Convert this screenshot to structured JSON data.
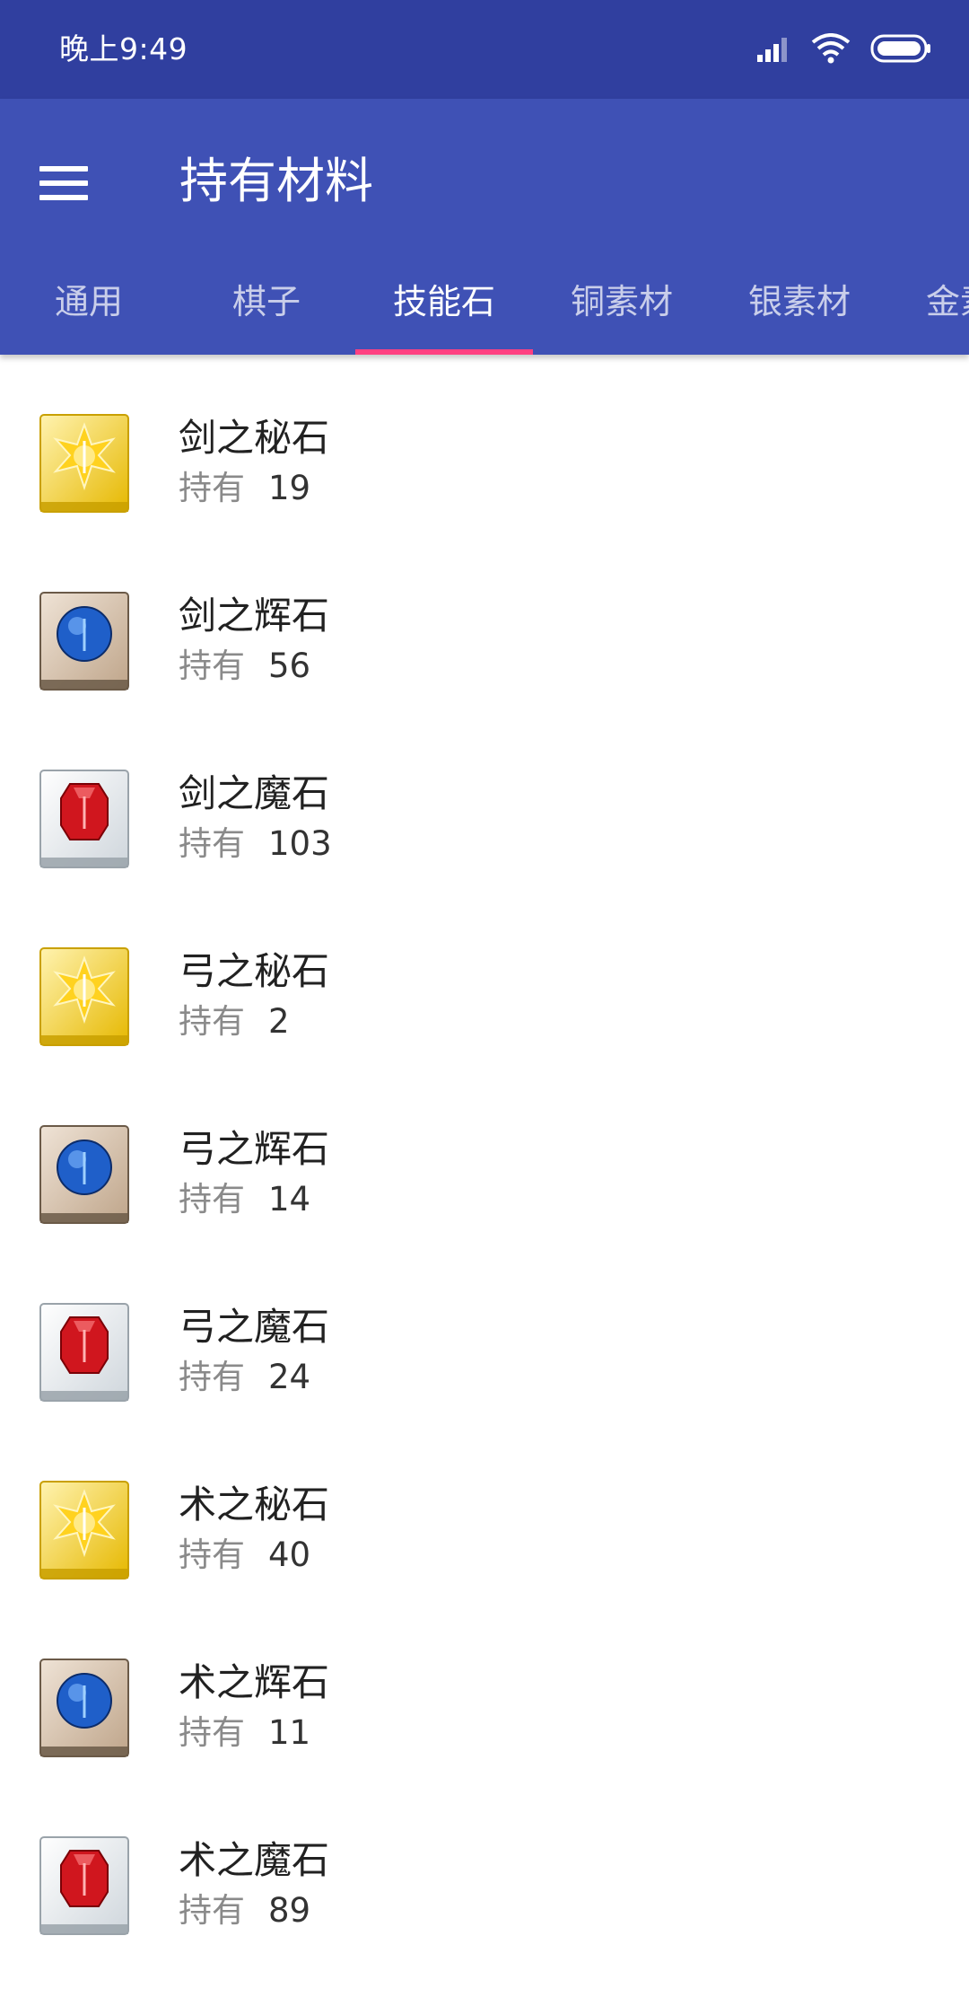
{
  "status_bar": {
    "time": "晚上9:49",
    "icons": [
      "signal-icon",
      "wifi-icon",
      "battery-icon"
    ]
  },
  "app_bar": {
    "title": "持有材料",
    "menu_icon": "menu-icon"
  },
  "tabs": [
    {
      "label": "通用",
      "active": false
    },
    {
      "label": "棋子",
      "active": false
    },
    {
      "label": "技能石",
      "active": true
    },
    {
      "label": "铜素材",
      "active": false
    },
    {
      "label": "银素材",
      "active": false
    },
    {
      "label": "金素材",
      "active": false
    }
  ],
  "colors": {
    "status_bar": "#303f9f",
    "app_bar": "#3f51b5",
    "tab_indicator": "#ff4081"
  },
  "items": [
    {
      "name": "剑之秘石",
      "qty_label": "持有",
      "qty": "19",
      "icon": "gold-sword-gem-icon",
      "tier": "gold"
    },
    {
      "name": "剑之辉石",
      "qty_label": "持有",
      "qty": "56",
      "icon": "blue-sword-gem-icon",
      "tier": "silver"
    },
    {
      "name": "剑之魔石",
      "qty_label": "持有",
      "qty": "103",
      "icon": "red-sword-gem-icon",
      "tier": "bronze"
    },
    {
      "name": "弓之秘石",
      "qty_label": "持有",
      "qty": "2",
      "icon": "gold-bow-gem-icon",
      "tier": "gold"
    },
    {
      "name": "弓之辉石",
      "qty_label": "持有",
      "qty": "14",
      "icon": "blue-bow-gem-icon",
      "tier": "silver"
    },
    {
      "name": "弓之魔石",
      "qty_label": "持有",
      "qty": "24",
      "icon": "red-bow-gem-icon",
      "tier": "bronze"
    },
    {
      "name": "术之秘石",
      "qty_label": "持有",
      "qty": "40",
      "icon": "gold-staff-gem-icon",
      "tier": "gold"
    },
    {
      "name": "术之辉石",
      "qty_label": "持有",
      "qty": "11",
      "icon": "blue-staff-gem-icon",
      "tier": "silver"
    },
    {
      "name": "术之魔石",
      "qty_label": "持有",
      "qty": "89",
      "icon": "red-staff-gem-icon",
      "tier": "bronze"
    }
  ]
}
